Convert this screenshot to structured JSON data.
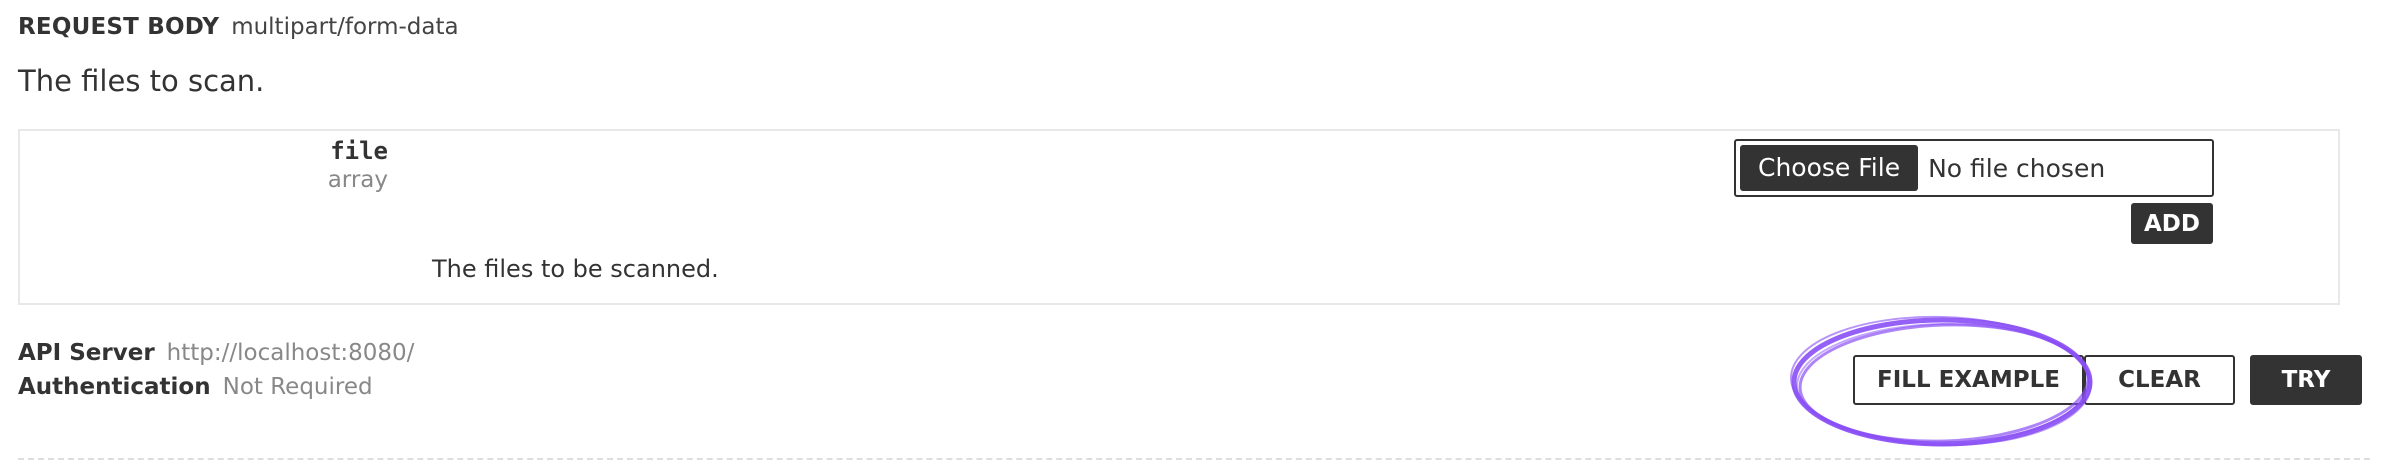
{
  "request_body": {
    "label": "REQUEST BODY",
    "content_type": "multipart/form-data",
    "description": "The files to scan."
  },
  "parameter": {
    "name": "file",
    "type": "array",
    "description": "The files to be scanned.",
    "file_input": {
      "button_label": "Choose File",
      "status_text": "No file chosen"
    },
    "add_label": "ADD"
  },
  "server": {
    "api_server_label": "API Server",
    "api_server_value": "http://localhost:8080/",
    "auth_label": "Authentication",
    "auth_value": "Not Required"
  },
  "actions": {
    "fill_example_label": "FILL EXAMPLE",
    "clear_label": "CLEAR",
    "try_label": "TRY"
  },
  "colors": {
    "dark": "#333333",
    "annotation": "#8a4ff5",
    "border": "#e8e8e8"
  }
}
